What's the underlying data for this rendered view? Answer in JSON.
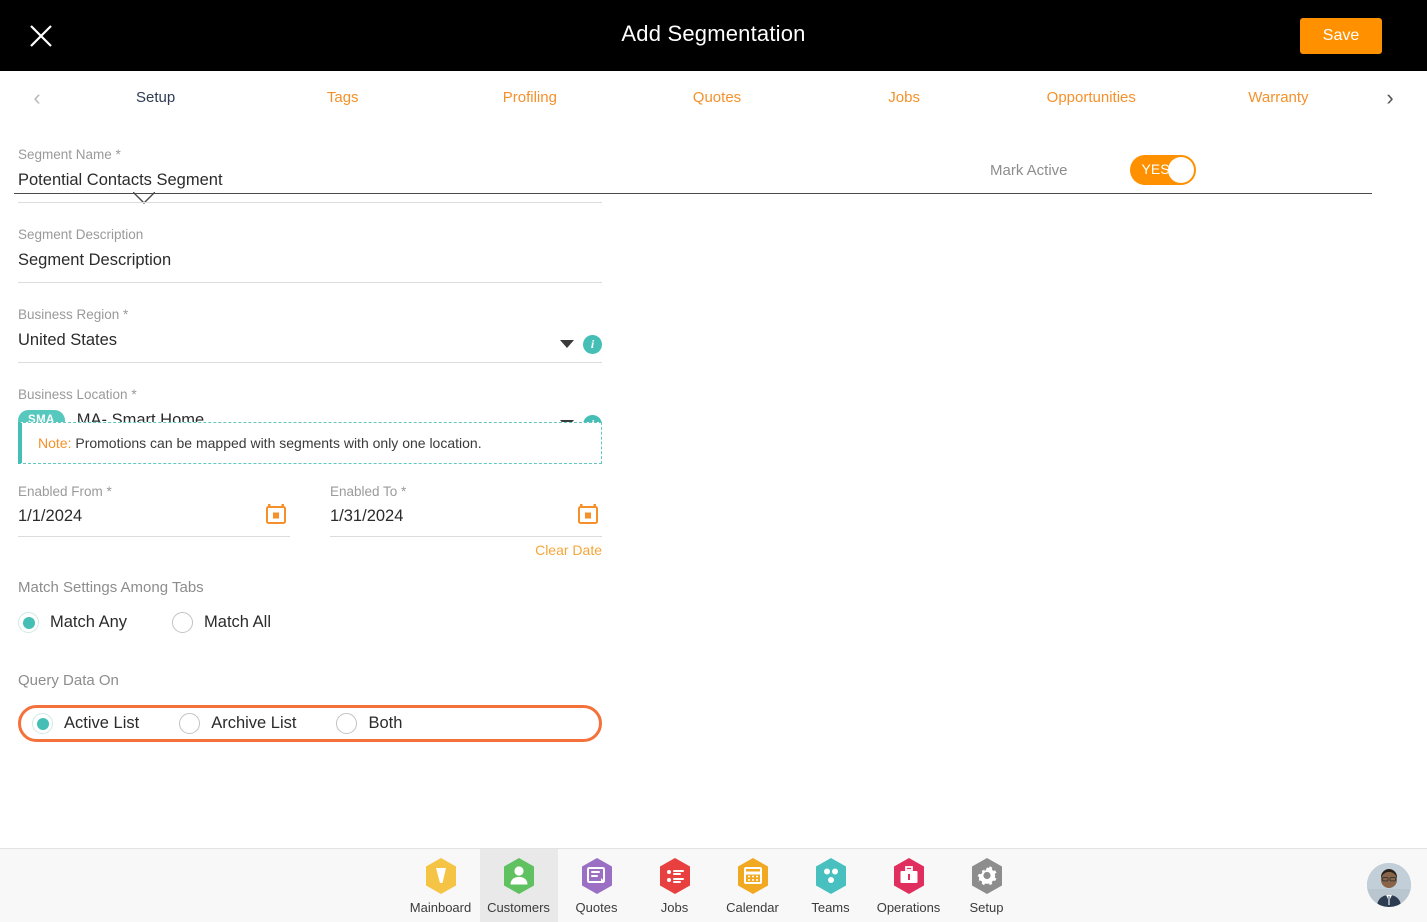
{
  "header": {
    "title": "Add Segmentation",
    "close_icon": "close-icon",
    "save_label": "Save"
  },
  "tabs": {
    "prev_arrow": "‹",
    "next_arrow": "›",
    "items": [
      {
        "label": "Setup",
        "active": true
      },
      {
        "label": "Tags",
        "active": false
      },
      {
        "label": "Profiling",
        "active": false
      },
      {
        "label": "Quotes",
        "active": false
      },
      {
        "label": "Jobs",
        "active": false
      },
      {
        "label": "Opportunities",
        "active": false
      },
      {
        "label": "Warranty",
        "active": false
      }
    ]
  },
  "form": {
    "segment_name": {
      "label": "Segment Name *",
      "value": "Potential Contacts Segment"
    },
    "segment_description": {
      "label": "Segment Description",
      "value": "Segment Description"
    },
    "business_region": {
      "label": "Business Region *",
      "value": "United States",
      "info": "i"
    },
    "business_location": {
      "label": "Business Location *",
      "badge": "SMA",
      "value": "MA- Smart Home",
      "info": "i"
    },
    "note": {
      "prefix": "Note:",
      "text": " Promotions can be mapped with segments with only one location."
    },
    "enabled_from": {
      "label": "Enabled From *",
      "value": "1/1/2024"
    },
    "enabled_to": {
      "label": "Enabled To *",
      "value": "1/31/2024"
    },
    "clear_date_label": "Clear Date",
    "match_settings": {
      "label": "Match Settings Among Tabs",
      "options": [
        {
          "label": "Match Any",
          "selected": true
        },
        {
          "label": "Match All",
          "selected": false
        }
      ]
    },
    "query_data": {
      "label": "Query Data On",
      "options": [
        {
          "label": "Active List",
          "selected": true
        },
        {
          "label": "Archive List",
          "selected": false
        },
        {
          "label": "Both",
          "selected": false
        }
      ]
    }
  },
  "mark_active": {
    "label": "Mark Active",
    "state_label": "YES",
    "on": true,
    "color": "#FF9100"
  },
  "footer": {
    "nav": [
      {
        "label": "Mainboard",
        "icon": "mainboard-icon",
        "color": "#F6C445",
        "active": false
      },
      {
        "label": "Customers",
        "icon": "customers-icon",
        "color": "#5FC15F",
        "active": true
      },
      {
        "label": "Quotes",
        "icon": "quotes-icon",
        "color": "#9B6FC4",
        "active": false
      },
      {
        "label": "Jobs",
        "icon": "jobs-icon",
        "color": "#E83F3F",
        "active": false
      },
      {
        "label": "Calendar",
        "icon": "calendar-icon",
        "color": "#F2A922",
        "active": false
      },
      {
        "label": "Teams",
        "icon": "teams-icon",
        "color": "#48C0C0",
        "active": false
      },
      {
        "label": "Operations",
        "icon": "operations-icon",
        "color": "#E02F5E",
        "active": false
      },
      {
        "label": "Setup",
        "icon": "setup-gear-icon",
        "color": "#8D8D8D",
        "active": false
      }
    ],
    "avatar": "user-avatar"
  },
  "colors": {
    "accent_orange": "#F5912B",
    "teal": "#45BFB5",
    "highlight": "#F4713B",
    "topbar": "#000000"
  }
}
